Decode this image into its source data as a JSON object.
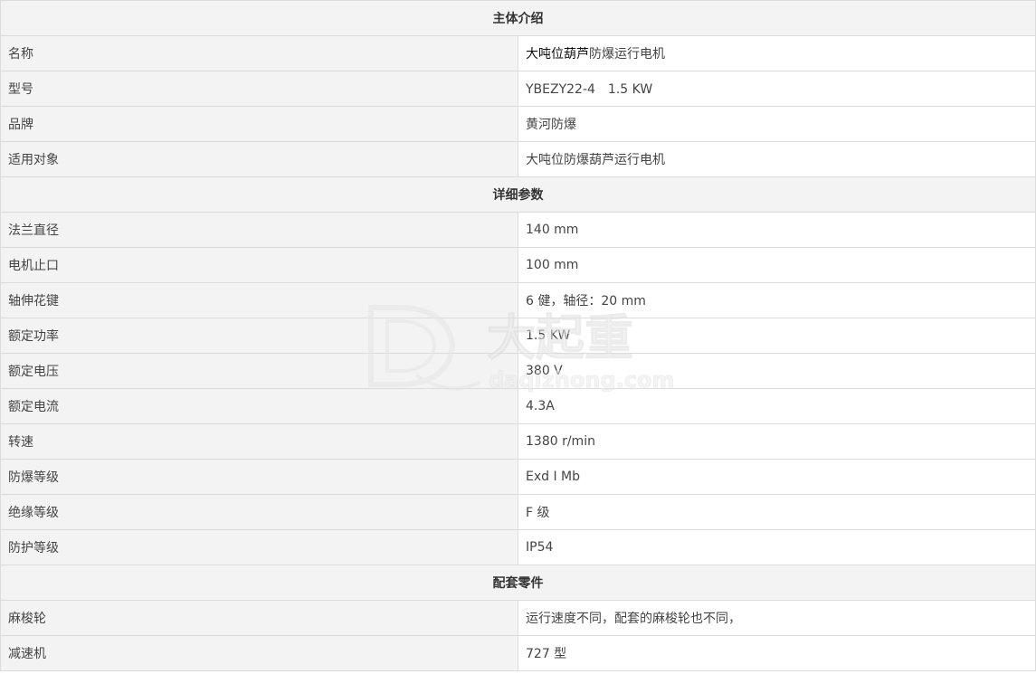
{
  "sections": {
    "intro": {
      "title": "主体介绍"
    },
    "params": {
      "title": "详细参数"
    },
    "parts": {
      "title": "配套零件"
    }
  },
  "intro_rows": [
    {
      "label": "名称",
      "value_strong": "大吨位葫芦",
      "value": "防爆运行电机"
    },
    {
      "label": "型号",
      "value": "YBEZY22-4　1.5 KW"
    },
    {
      "label": "品牌",
      "value": "黄河防爆"
    },
    {
      "label": "适用对象",
      "value": "大吨位防爆葫芦运行电机"
    }
  ],
  "param_rows": [
    {
      "label": "法兰直径",
      "value": "140 mm"
    },
    {
      "label": "电机止口",
      "value": "100 mm"
    },
    {
      "label": "轴伸花键",
      "value": "6 健，轴径：20 mm"
    },
    {
      "label": "额定功率",
      "value": "1.5 KW"
    },
    {
      "label": "额定电压",
      "value": "380 V"
    },
    {
      "label": "额定电流",
      "value": "4.3A"
    },
    {
      "label": "转速",
      "value": "1380 r/min"
    },
    {
      "label": "防爆等级",
      "value": "Exd I Mb"
    },
    {
      "label": "绝缘等级",
      "value": "F 级"
    },
    {
      "label": "防护等级",
      "value": "IP54"
    }
  ],
  "part_rows": [
    {
      "label": "麻梭轮",
      "value": "运行速度不同，配套的麻梭轮也不同，"
    },
    {
      "label": "减速机",
      "value": "727 型"
    }
  ],
  "watermark": {
    "brand_text": "大起重",
    "domain_text": "daqizhong.com"
  }
}
